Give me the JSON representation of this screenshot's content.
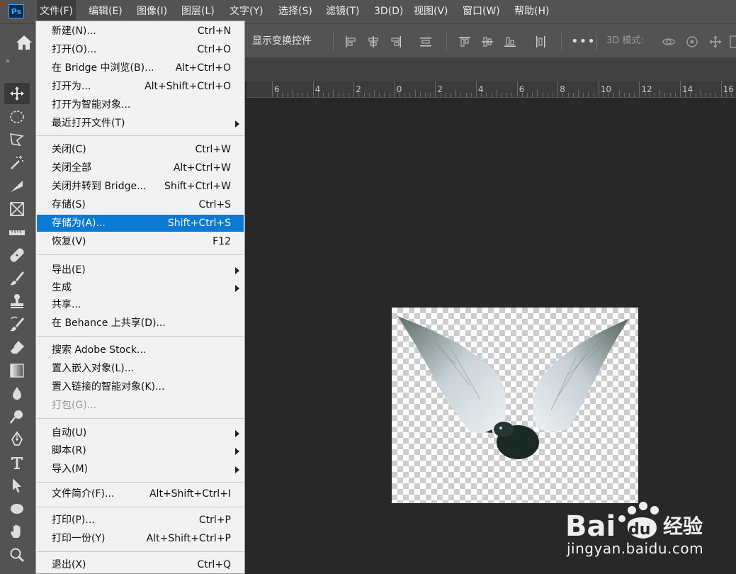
{
  "app": {
    "logo": "Ps"
  },
  "menubar": [
    {
      "label": "文件(F)",
      "active": true
    },
    {
      "label": "编辑(E)"
    },
    {
      "label": "图像(I)"
    },
    {
      "label": "图层(L)"
    },
    {
      "label": "文字(Y)"
    },
    {
      "label": "选择(S)"
    },
    {
      "label": "滤镜(T)"
    },
    {
      "label": "3D(D)"
    },
    {
      "label": "视图(V)"
    },
    {
      "label": "窗口(W)"
    },
    {
      "label": "帮助(H)"
    }
  ],
  "options_bar": {
    "show_transform_controls": "显示变换控件",
    "more": "•••",
    "mode_3d": "3D 模式:"
  },
  "ruler": {
    "labels": [
      "6",
      "4",
      "2",
      "0",
      "2",
      "4",
      "6",
      "8",
      "10",
      "12",
      "14",
      "16"
    ]
  },
  "file_menu": {
    "items": [
      {
        "label": "新建(N)...",
        "shortcut": "Ctrl+N"
      },
      {
        "label": "打开(O)...",
        "shortcut": "Ctrl+O"
      },
      {
        "label": "在 Bridge 中浏览(B)...",
        "shortcut": "Alt+Ctrl+O"
      },
      {
        "label": "打开为...",
        "shortcut": "Alt+Shift+Ctrl+O"
      },
      {
        "label": "打开为智能对象...",
        "shortcut": ""
      },
      {
        "label": "最近打开文件(T)",
        "shortcut": "",
        "submenu": true
      },
      {
        "label": "关闭(C)",
        "shortcut": "Ctrl+W"
      },
      {
        "label": "关闭全部",
        "shortcut": "Alt+Ctrl+W"
      },
      {
        "label": "关闭并转到 Bridge...",
        "shortcut": "Shift+Ctrl+W"
      },
      {
        "label": "存储(S)",
        "shortcut": "Ctrl+S"
      },
      {
        "label": "存储为(A)...",
        "shortcut": "Shift+Ctrl+S",
        "highlighted": true
      },
      {
        "label": "恢复(V)",
        "shortcut": "F12"
      },
      {
        "label": "导出(E)",
        "shortcut": "",
        "submenu": true
      },
      {
        "label": "生成",
        "shortcut": "",
        "submenu": true
      },
      {
        "label": "共享...",
        "shortcut": ""
      },
      {
        "label": "在 Behance 上共享(D)...",
        "shortcut": ""
      },
      {
        "label": "搜索 Adobe Stock...",
        "shortcut": ""
      },
      {
        "label": "置入嵌入对象(L)...",
        "shortcut": ""
      },
      {
        "label": "置入链接的智能对象(K)...",
        "shortcut": ""
      },
      {
        "label": "打包(G)...",
        "shortcut": "",
        "disabled": true
      },
      {
        "label": "自动(U)",
        "shortcut": "",
        "submenu": true
      },
      {
        "label": "脚本(R)",
        "shortcut": "",
        "submenu": true
      },
      {
        "label": "导入(M)",
        "shortcut": "",
        "submenu": true
      },
      {
        "label": "文件简介(F)...",
        "shortcut": "Alt+Shift+Ctrl+I"
      },
      {
        "label": "打印(P)...",
        "shortcut": "Ctrl+P"
      },
      {
        "label": "打印一份(Y)",
        "shortcut": "Alt+Shift+Ctrl+P"
      },
      {
        "label": "退出(X)",
        "shortcut": "Ctrl+Q"
      }
    ]
  },
  "watermark": {
    "brand": "Bai",
    "brand2": "du",
    "cn": "经验",
    "url": "jingyan.baidu.com"
  },
  "colors": {
    "highlight": "#0b7ad4",
    "chrome": "#535353",
    "canvas_bg": "#282828"
  }
}
